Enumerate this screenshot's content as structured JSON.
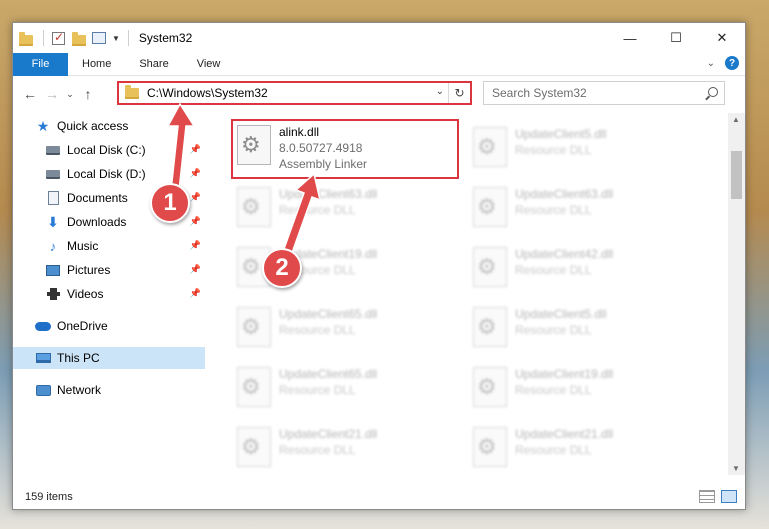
{
  "window": {
    "title": "System32"
  },
  "ribbon": {
    "tabs": [
      {
        "label": "File"
      },
      {
        "label": "Home"
      },
      {
        "label": "Share"
      },
      {
        "label": "View"
      }
    ]
  },
  "controls": {
    "minimize": "—",
    "maximize": "☐",
    "close": "✕",
    "help": "?"
  },
  "nav": {
    "path": "C:\\Windows\\System32",
    "search_placeholder": "Search System32"
  },
  "sidebar": {
    "items": [
      {
        "label": "Quick access",
        "icon": "star-icon"
      },
      {
        "label": "Local Disk (C:)",
        "icon": "disk-icon",
        "pinned": true
      },
      {
        "label": "Local Disk (D:)",
        "icon": "disk-icon",
        "pinned": true
      },
      {
        "label": "Documents",
        "icon": "documents-icon",
        "pinned": true
      },
      {
        "label": "Downloads",
        "icon": "download-icon",
        "pinned": true
      },
      {
        "label": "Music",
        "icon": "music-icon",
        "pinned": true
      },
      {
        "label": "Pictures",
        "icon": "pictures-icon",
        "pinned": true
      },
      {
        "label": "Videos",
        "icon": "videos-icon",
        "pinned": true
      },
      {
        "label": "OneDrive",
        "icon": "cloud-icon"
      },
      {
        "label": "This PC",
        "icon": "computer-icon",
        "selected": true
      },
      {
        "label": "Network",
        "icon": "network-icon"
      }
    ]
  },
  "files": [
    {
      "name": "alink.dll",
      "line2": "8.0.50727.4918",
      "line3": "Assembly Linker",
      "highlight": true
    },
    {
      "name": "UpdateClient5.dll",
      "line2": "Resource DLL"
    },
    {
      "name": "UpdateClient63.dll",
      "line2": "Resource DLL"
    },
    {
      "name": "UpdateClient63.dll",
      "line2": "Resource DLL"
    },
    {
      "name": "UpdateClient19.dll",
      "line2": "Resource DLL"
    },
    {
      "name": "UpdateClient42.dll",
      "line2": "Resource DLL"
    },
    {
      "name": "UpdateClient65.dll",
      "line2": "Resource DLL"
    },
    {
      "name": "UpdateClient5.dll",
      "line2": "Resource DLL"
    },
    {
      "name": "UpdateClient65.dll",
      "line2": "Resource DLL"
    },
    {
      "name": "UpdateClient19.dll",
      "line2": "Resource DLL"
    },
    {
      "name": "UpdateClient21.dll",
      "line2": "Resource DLL"
    },
    {
      "name": "UpdateClient21.dll",
      "line2": "Resource DLL"
    }
  ],
  "status": {
    "count": "159 items"
  },
  "annotations": {
    "badge1": "1",
    "badge2": "2",
    "color": "#e04a4a"
  }
}
